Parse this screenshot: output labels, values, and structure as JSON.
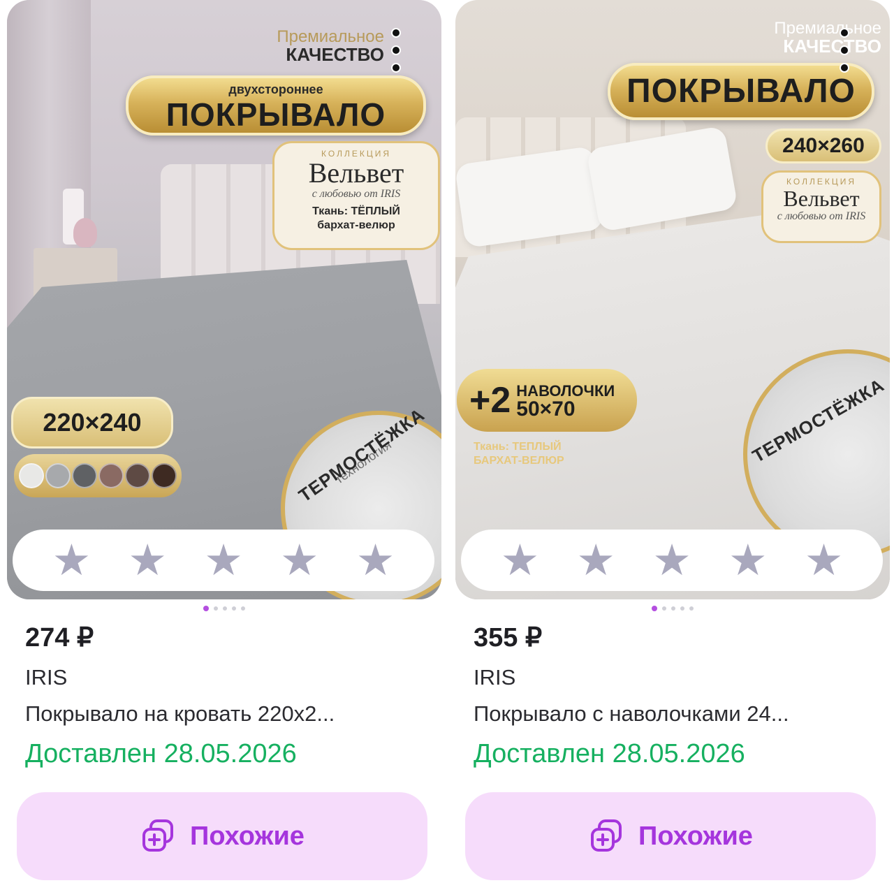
{
  "products": [
    {
      "price": "274 ₽",
      "brand": "IRIS",
      "title": "Покрывало на кровать 220х2...",
      "delivery": "Доставлен 28.05.2026",
      "similar_label": "Похожие",
      "rating_stars": 5,
      "image_page_count": 5,
      "image_active_page": 1,
      "image_text": {
        "premium_line1": "Премиальное",
        "premium_line2": "КАЧЕСТВО",
        "banner_sub": "двухстороннее",
        "banner_main": "ПОКРЫВАЛО",
        "collection_small": "КОЛЛЕКЦИЯ",
        "collection_name": "Вельвет",
        "collection_sig": "с любовью от IRIS",
        "fabric_line1": "Ткань: ТЁПЛЫЙ",
        "fabric_line2": "бархат-велюр",
        "size": "220×240",
        "thermo": "ТЕРМОСТЁЖКА",
        "thermo_sub": "технология"
      },
      "swatch_colors": [
        "#e8e8e6",
        "#a7a9ac",
        "#5f6164",
        "#8a6a63",
        "#5e4a44",
        "#3e2a22"
      ]
    },
    {
      "price": "355 ₽",
      "brand": "IRIS",
      "title": "Покрывало с наволочками 24...",
      "delivery": "Доставлен 28.05.2026",
      "similar_label": "Похожие",
      "rating_stars": 5,
      "image_page_count": 5,
      "image_active_page": 1,
      "image_text": {
        "premium_line1": "Премиальное",
        "premium_line2": "КАЧЕСТВО",
        "banner_main": "ПОКРЫВАЛО",
        "size": "240×260",
        "collection_small": "КОЛЛЕКЦИЯ",
        "collection_name": "Вельвет",
        "collection_sig": "с любовью от IRIS",
        "pillow_plus": "+2",
        "pillow_line1": "НАВОЛОЧКИ",
        "pillow_line2": "50×70",
        "fabric_line1": "Ткань: ТЕПЛЫЙ",
        "fabric_line2": "БАРХАТ-ВЕЛЮР",
        "thermo": "ТЕРМОСТЁЖКА"
      }
    }
  ],
  "icons": {
    "star": "star-icon",
    "more": "more-vertical-icon",
    "similar": "similar-items-icon"
  },
  "colors": {
    "accent": "#a535dd",
    "button_bg": "#f6dcfb",
    "delivered": "#16b060",
    "star": "#a9a8bd",
    "pager_active": "#b44fe0"
  }
}
